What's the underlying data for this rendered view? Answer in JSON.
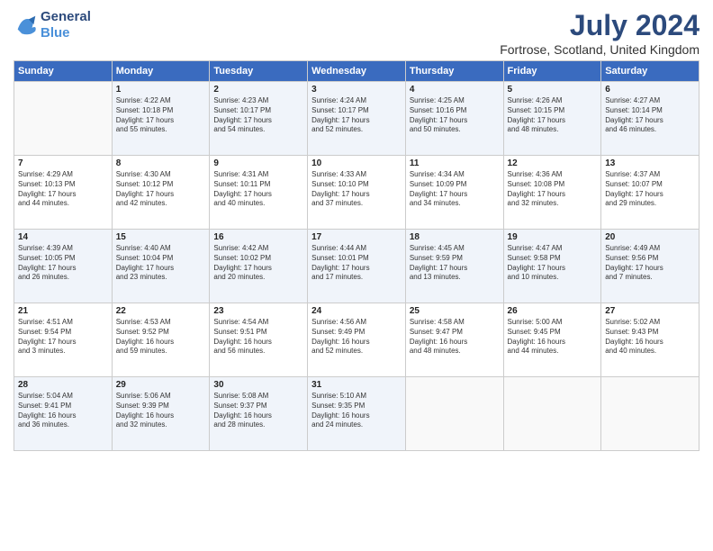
{
  "header": {
    "month_title": "July 2024",
    "subtitle": "Fortrose, Scotland, United Kingdom"
  },
  "columns": [
    "Sunday",
    "Monday",
    "Tuesday",
    "Wednesday",
    "Thursday",
    "Friday",
    "Saturday"
  ],
  "weeks": [
    [
      {
        "day": "",
        "text": ""
      },
      {
        "day": "1",
        "text": "Sunrise: 4:22 AM\nSunset: 10:18 PM\nDaylight: 17 hours\nand 55 minutes."
      },
      {
        "day": "2",
        "text": "Sunrise: 4:23 AM\nSunset: 10:17 PM\nDaylight: 17 hours\nand 54 minutes."
      },
      {
        "day": "3",
        "text": "Sunrise: 4:24 AM\nSunset: 10:17 PM\nDaylight: 17 hours\nand 52 minutes."
      },
      {
        "day": "4",
        "text": "Sunrise: 4:25 AM\nSunset: 10:16 PM\nDaylight: 17 hours\nand 50 minutes."
      },
      {
        "day": "5",
        "text": "Sunrise: 4:26 AM\nSunset: 10:15 PM\nDaylight: 17 hours\nand 48 minutes."
      },
      {
        "day": "6",
        "text": "Sunrise: 4:27 AM\nSunset: 10:14 PM\nDaylight: 17 hours\nand 46 minutes."
      }
    ],
    [
      {
        "day": "7",
        "text": "Sunrise: 4:29 AM\nSunset: 10:13 PM\nDaylight: 17 hours\nand 44 minutes."
      },
      {
        "day": "8",
        "text": "Sunrise: 4:30 AM\nSunset: 10:12 PM\nDaylight: 17 hours\nand 42 minutes."
      },
      {
        "day": "9",
        "text": "Sunrise: 4:31 AM\nSunset: 10:11 PM\nDaylight: 17 hours\nand 40 minutes."
      },
      {
        "day": "10",
        "text": "Sunrise: 4:33 AM\nSunset: 10:10 PM\nDaylight: 17 hours\nand 37 minutes."
      },
      {
        "day": "11",
        "text": "Sunrise: 4:34 AM\nSunset: 10:09 PM\nDaylight: 17 hours\nand 34 minutes."
      },
      {
        "day": "12",
        "text": "Sunrise: 4:36 AM\nSunset: 10:08 PM\nDaylight: 17 hours\nand 32 minutes."
      },
      {
        "day": "13",
        "text": "Sunrise: 4:37 AM\nSunset: 10:07 PM\nDaylight: 17 hours\nand 29 minutes."
      }
    ],
    [
      {
        "day": "14",
        "text": "Sunrise: 4:39 AM\nSunset: 10:05 PM\nDaylight: 17 hours\nand 26 minutes."
      },
      {
        "day": "15",
        "text": "Sunrise: 4:40 AM\nSunset: 10:04 PM\nDaylight: 17 hours\nand 23 minutes."
      },
      {
        "day": "16",
        "text": "Sunrise: 4:42 AM\nSunset: 10:02 PM\nDaylight: 17 hours\nand 20 minutes."
      },
      {
        "day": "17",
        "text": "Sunrise: 4:44 AM\nSunset: 10:01 PM\nDaylight: 17 hours\nand 17 minutes."
      },
      {
        "day": "18",
        "text": "Sunrise: 4:45 AM\nSunset: 9:59 PM\nDaylight: 17 hours\nand 13 minutes."
      },
      {
        "day": "19",
        "text": "Sunrise: 4:47 AM\nSunset: 9:58 PM\nDaylight: 17 hours\nand 10 minutes."
      },
      {
        "day": "20",
        "text": "Sunrise: 4:49 AM\nSunset: 9:56 PM\nDaylight: 17 hours\nand 7 minutes."
      }
    ],
    [
      {
        "day": "21",
        "text": "Sunrise: 4:51 AM\nSunset: 9:54 PM\nDaylight: 17 hours\nand 3 minutes."
      },
      {
        "day": "22",
        "text": "Sunrise: 4:53 AM\nSunset: 9:52 PM\nDaylight: 16 hours\nand 59 minutes."
      },
      {
        "day": "23",
        "text": "Sunrise: 4:54 AM\nSunset: 9:51 PM\nDaylight: 16 hours\nand 56 minutes."
      },
      {
        "day": "24",
        "text": "Sunrise: 4:56 AM\nSunset: 9:49 PM\nDaylight: 16 hours\nand 52 minutes."
      },
      {
        "day": "25",
        "text": "Sunrise: 4:58 AM\nSunset: 9:47 PM\nDaylight: 16 hours\nand 48 minutes."
      },
      {
        "day": "26",
        "text": "Sunrise: 5:00 AM\nSunset: 9:45 PM\nDaylight: 16 hours\nand 44 minutes."
      },
      {
        "day": "27",
        "text": "Sunrise: 5:02 AM\nSunset: 9:43 PM\nDaylight: 16 hours\nand 40 minutes."
      }
    ],
    [
      {
        "day": "28",
        "text": "Sunrise: 5:04 AM\nSunset: 9:41 PM\nDaylight: 16 hours\nand 36 minutes."
      },
      {
        "day": "29",
        "text": "Sunrise: 5:06 AM\nSunset: 9:39 PM\nDaylight: 16 hours\nand 32 minutes."
      },
      {
        "day": "30",
        "text": "Sunrise: 5:08 AM\nSunset: 9:37 PM\nDaylight: 16 hours\nand 28 minutes."
      },
      {
        "day": "31",
        "text": "Sunrise: 5:10 AM\nSunset: 9:35 PM\nDaylight: 16 hours\nand 24 minutes."
      },
      {
        "day": "",
        "text": ""
      },
      {
        "day": "",
        "text": ""
      },
      {
        "day": "",
        "text": ""
      }
    ]
  ]
}
